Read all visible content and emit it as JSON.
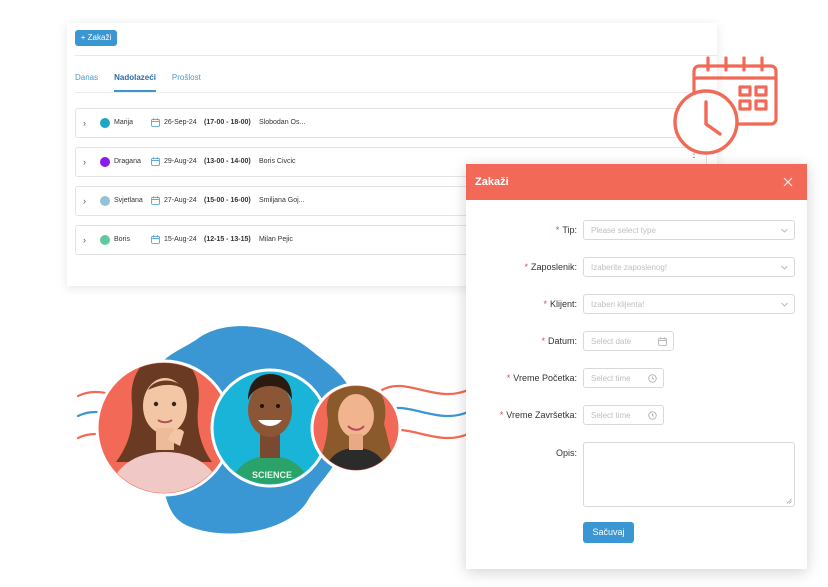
{
  "toolbar": {
    "add_label": "+ Zakaži"
  },
  "tabs": [
    {
      "label": "Danas",
      "active": false
    },
    {
      "label": "Nadolazeći",
      "active": true
    },
    {
      "label": "Prošlost",
      "active": false
    }
  ],
  "appointments": [
    {
      "client": "Marija",
      "color": "#1ea7c5",
      "date": "26-Sep-24",
      "time": "(17-00 - 18-00)",
      "employee": "Slobodan Os..."
    },
    {
      "client": "Dragana",
      "color": "#8b1be8",
      "date": "29-Aug-24",
      "time": "(13-00 - 14-00)",
      "employee": "Boris Civcic"
    },
    {
      "client": "Svjetlana",
      "color": "#93c2d4",
      "date": "27-Aug-24",
      "time": "(15-00 - 16-00)",
      "employee": "Smiljana Goj..."
    },
    {
      "client": "Boris",
      "color": "#5fcb9c",
      "date": "15-Aug-24",
      "time": "(12-15 - 13-15)",
      "employee": "Milan Pejic"
    }
  ],
  "modal": {
    "title": "Zakaži",
    "fields": {
      "tip": {
        "label": "Tip",
        "placeholder": "Please select type"
      },
      "zaposlenik": {
        "label": "Zaposlenik",
        "placeholder": "Izaberite zaposlenog!"
      },
      "klijent": {
        "label": "Klijent",
        "placeholder": "Izaberi klijenta!"
      },
      "datum": {
        "label": "Datum",
        "placeholder": "Select date"
      },
      "vreme_pocetka": {
        "label": "Vreme Početka",
        "placeholder": "Select time"
      },
      "vreme_zavrsetka": {
        "label": "Vreme Završetka",
        "placeholder": "Select time"
      },
      "opis": {
        "label": "Opis"
      }
    },
    "save_label": "Sačuvaj",
    "header_color": "#f26957"
  },
  "people_image": {
    "shirt_text": "SCIENCE"
  },
  "colors": {
    "primary": "#3b96d4",
    "accent": "#f26957",
    "blob": "#3b96d4"
  },
  "icons": {
    "calendar_clock": "calendar-clock-icon",
    "row_calendar": "calendar-icon",
    "expand": "chevron-right-icon",
    "menu": "more-vertical-icon",
    "close": "close-icon"
  }
}
